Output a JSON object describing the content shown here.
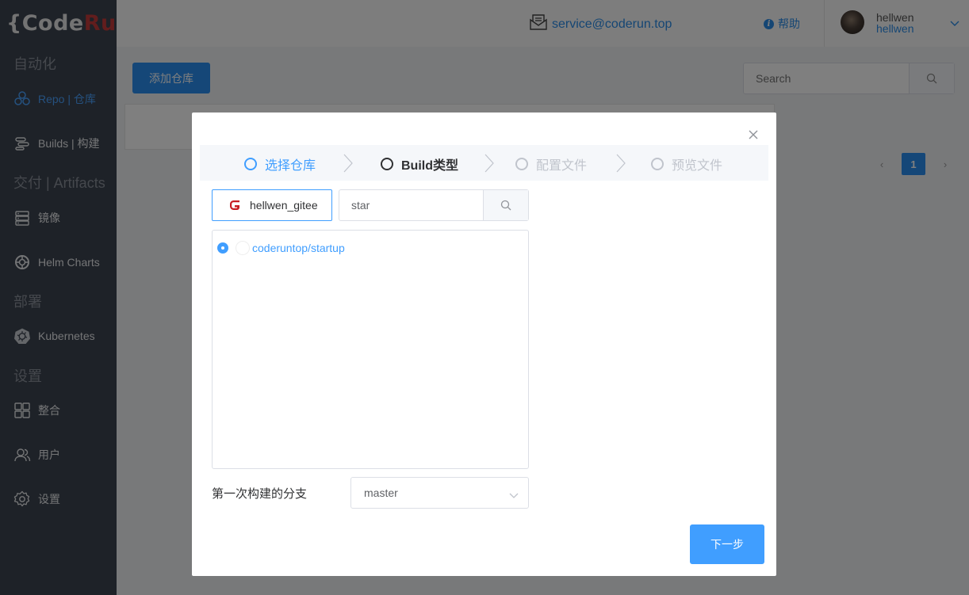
{
  "brand": {
    "open_brace": "{",
    "code": "Code",
    "run": "Run",
    "close_brace": "}"
  },
  "sidebar": {
    "sections": [
      {
        "title": "自动化"
      },
      {
        "title": "交付 | Artifacts"
      },
      {
        "title": "部署"
      },
      {
        "title": "设置"
      }
    ],
    "items": [
      {
        "label": "Repo | 仓库",
        "icon": "repo-icon"
      },
      {
        "label": "Builds | 构建",
        "icon": "builds-icon"
      },
      {
        "label": "镜像",
        "icon": "image-icon"
      },
      {
        "label": "Helm Charts",
        "icon": "helm-icon"
      },
      {
        "label": "Kubernetes",
        "icon": "kubernetes-icon"
      },
      {
        "label": "整合",
        "icon": "integration-icon"
      },
      {
        "label": "用户",
        "icon": "users-icon"
      },
      {
        "label": "设置",
        "icon": "settings-icon"
      }
    ]
  },
  "header": {
    "email": "service@coderun.top",
    "help": "帮助",
    "user_name": "hellwen",
    "user_login": "hellwen"
  },
  "content": {
    "add_repo": "添加仓库",
    "search_placeholder": "Search",
    "pagination": {
      "prev": "‹",
      "current": "1",
      "next": "›"
    }
  },
  "modal": {
    "steps": [
      {
        "label": "选择仓库",
        "state": "done"
      },
      {
        "label": "Build类型",
        "state": "active"
      },
      {
        "label": "配置文件",
        "state": "pending"
      },
      {
        "label": "预览文件",
        "state": "pending"
      }
    ],
    "provider": "hellwen_gitee",
    "repo_search_value": "star",
    "repos": [
      {
        "name": "coderuntop/startup",
        "selected": true
      }
    ],
    "branch_label": "第一次构建的分支",
    "branch_value": "master",
    "next": "下一步"
  },
  "colors": {
    "primary": "#409eff",
    "sidebar_bg": "#3d4450",
    "brand_run": "#c23a3a",
    "gitee_red": "#c71d23"
  }
}
